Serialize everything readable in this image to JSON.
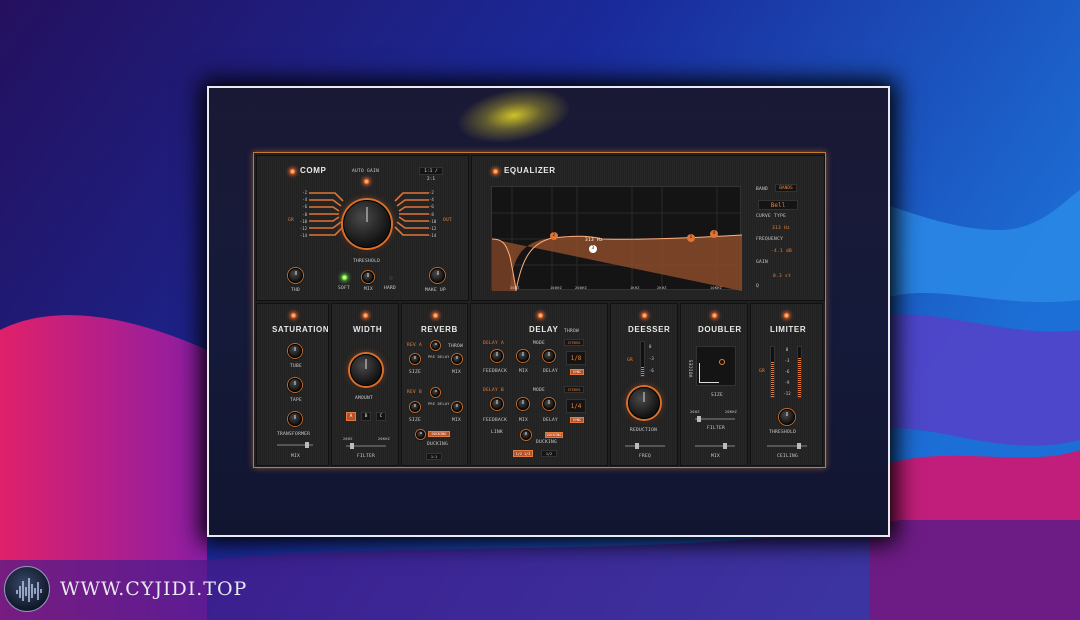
{
  "watermark": {
    "text": "WWW.CYJIDI.TOP",
    "logo_icon": "waveform-logo"
  },
  "colors": {
    "accent": "#e8823a",
    "led_green": "#55c23a",
    "frame": "#e9e9ee"
  },
  "comp": {
    "title": "COMP",
    "auto_gain": "AUTO GAIN",
    "top_tag": "1:1 / 2:1",
    "threshold": "THRESHOLD",
    "left_side": "GR",
    "right_side": "OUT",
    "scale": [
      "-2",
      "-4",
      "-6",
      "-8",
      "-10",
      "-12",
      "-14"
    ],
    "thd": "THD",
    "soft": "SOFT",
    "mix": "MIX",
    "hard": "HARD",
    "make_up": "MAKE UP"
  },
  "equalizer": {
    "title": "EQUALIZER",
    "band_label": "BAND",
    "band_value": "BANDS",
    "type_value": "Bell",
    "curve_type_label": "CURVE TYPE",
    "curve_type_value": "313 Hz",
    "frequency_label": "FREQUENCY",
    "frequency_value": "-4.1 dB",
    "gain_label": "GAIN",
    "gain_value": "0.3 st",
    "q_label": "Q",
    "point_label": "313 Hz",
    "bands": [
      "1",
      "2",
      "3",
      "4"
    ],
    "freq_ticks": [
      "30HZ",
      "100HZ",
      "200HZ",
      "1KHZ",
      "2KHZ",
      "10KHZ"
    ]
  },
  "saturation": {
    "title": "SATURATION",
    "tube": "TUBE",
    "tape": "TAPE",
    "transformer": "TRANSFORMER",
    "mix": "MIX"
  },
  "width": {
    "title": "WIDTH",
    "amount": "AMOUNT",
    "buttons": [
      "A",
      "B",
      "C"
    ],
    "filter_lo": "20HZ",
    "filter_hi": "20KHZ",
    "filter": "FILTER"
  },
  "reverb": {
    "title": "REVERB",
    "rev_a": "REV A",
    "rev_b": "REV B",
    "pre_delay": "PRE DELAY",
    "throw": "THROW",
    "size": "SIZE",
    "mix": "MIX",
    "ducking": "DUCKING",
    "ducking_tag": "DUCKING",
    "small_tag": "1:1"
  },
  "delay": {
    "title": "DELAY",
    "throw": "THROW",
    "delay_a": "DELAY A",
    "delay_b": "DELAY B",
    "mode": "MODE",
    "stereo": "STEREO",
    "feedback": "FEEDBACK",
    "mix": "MIX",
    "delay": "DELAY",
    "value_a": "1/8",
    "value_b": "1/4",
    "sync": "SYNC",
    "link": "LINK",
    "ducking": "DUCKING",
    "ducking_tag": "DUCKING",
    "bottom_a": "1/2 1/3",
    "bottom_b": "1/2"
  },
  "deesser": {
    "title": "DEESSER",
    "scale": [
      "0",
      "-3",
      "-6"
    ],
    "side": "GR",
    "reduction": "REDUCTION",
    "freq": "FREQ"
  },
  "doubler": {
    "title": "DOUBLER",
    "voices": "VOICES",
    "size": "SIZE",
    "filter_lo": "20HZ",
    "filter_hi": "20KHZ",
    "filter": "FILTER",
    "mix": "MIX"
  },
  "limiter": {
    "title": "LIMITER",
    "scale": [
      "0",
      "-3",
      "-6",
      "-9",
      "-12"
    ],
    "side": "GR",
    "threshold": "THRESHOLD",
    "ceiling": "CEILING"
  }
}
